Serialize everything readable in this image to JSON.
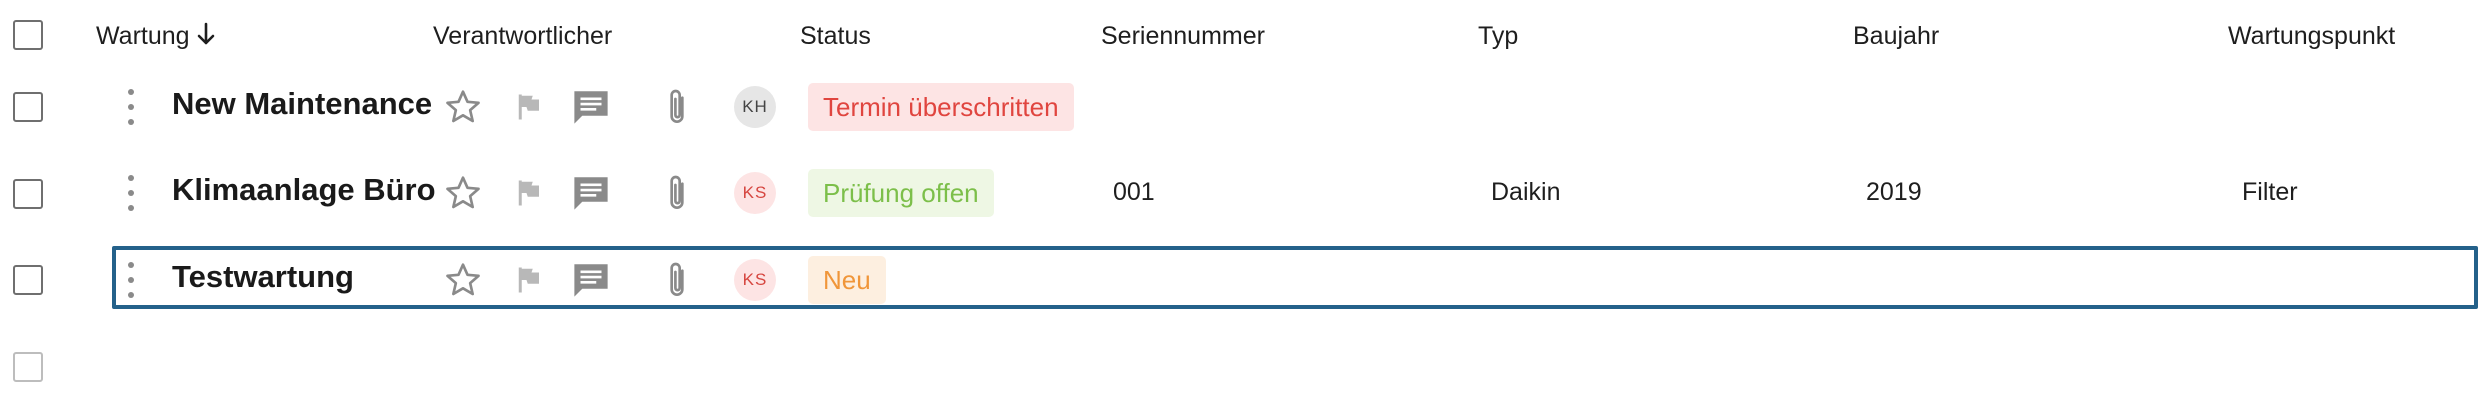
{
  "header": {
    "columns": {
      "wartung": "Wartung",
      "verantwortlicher": "Verantwortlicher",
      "status": "Status",
      "seriennummer": "Seriennummer",
      "typ": "Typ",
      "baujahr": "Baujahr",
      "wartungspunkt": "Wartungspunkt"
    },
    "sort": {
      "column": "wartung",
      "direction": "descending"
    }
  },
  "rows": [
    {
      "title": "New Maintenance",
      "assignee_initials": "KH",
      "assignee_color": "#e6e6e6",
      "assignee_text_color": "#444444",
      "status": "Termin überschritten",
      "status_text_color": "#e0453f",
      "status_bg_color": "#fde4e4",
      "seriennummer": "",
      "typ": "",
      "baujahr": "",
      "wartungspunkt": ""
    },
    {
      "title": "Klimaanlage Büro",
      "assignee_initials": "KS",
      "assignee_color": "#fde4e4",
      "assignee_text_color": "#d6453f",
      "status": "Prüfung offen",
      "status_text_color": "#7cbf4a",
      "status_bg_color": "#eef7e4",
      "seriennummer": "001",
      "typ": "Daikin",
      "baujahr": "2019",
      "wartungspunkt": "Filter"
    },
    {
      "title": "Testwartung",
      "assignee_initials": "KS",
      "assignee_color": "#fde4e4",
      "assignee_text_color": "#d6453f",
      "status": "Neu",
      "status_text_color": "#f0963a",
      "status_bg_color": "#fdefe0",
      "seriennummer": "",
      "typ": "",
      "baujahr": "",
      "wartungspunkt": "",
      "selected_focus": true
    }
  ],
  "icons": {
    "drag": "drag-handle-icon",
    "favorite": "star-icon",
    "flag": "flag-icon",
    "comment": "comment-icon",
    "attachment": "paperclip-icon",
    "sort": "arrow-down-icon"
  },
  "colors": {
    "focus_border": "#24618a",
    "icon_grey": "#8a8a8a",
    "flag_grey": "#b8b8b8"
  }
}
